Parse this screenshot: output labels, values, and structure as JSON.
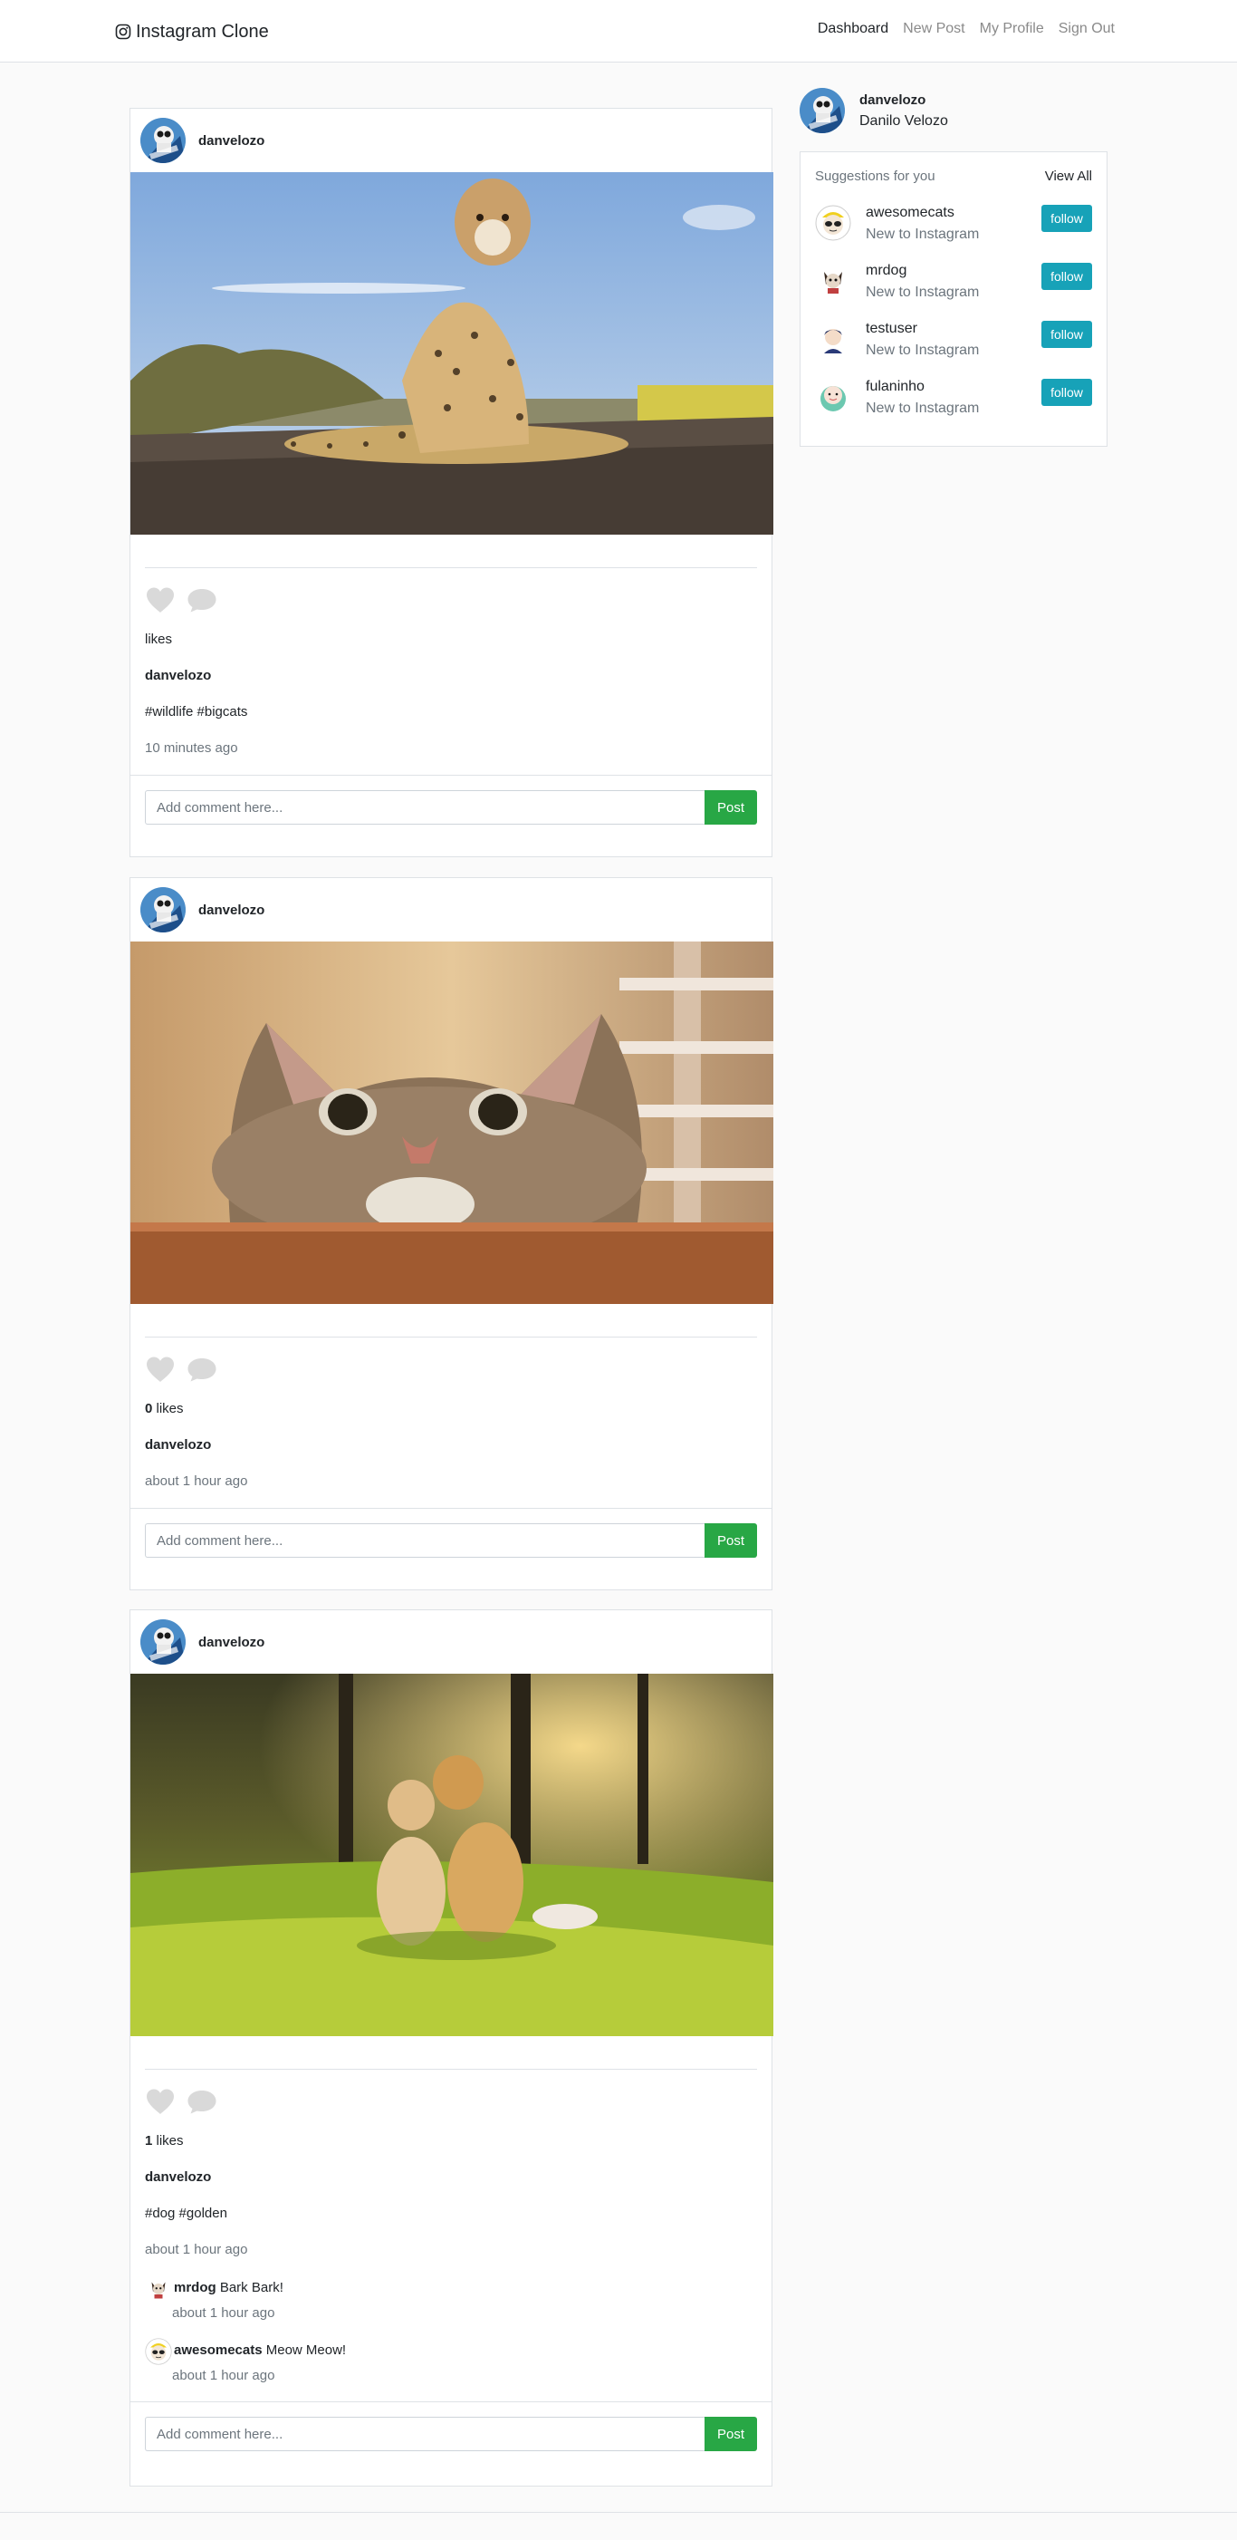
{
  "navbar": {
    "brand": "Instagram Clone",
    "links": [
      "Dashboard",
      "New Post",
      "My Profile",
      "Sign Out"
    ]
  },
  "posts": [
    {
      "username": "danvelozo",
      "likes_count": "",
      "likes_label": "likes",
      "author": "danvelozo",
      "caption": "#wildlife #bigcats",
      "time": "10 minutes ago",
      "comments": [],
      "comment_placeholder": "Add comment here...",
      "post_button": "Post"
    },
    {
      "username": "danvelozo",
      "likes_count": "0",
      "likes_label": " likes",
      "author": "danvelozo",
      "caption": "",
      "time": "about 1 hour ago",
      "comments": [],
      "comment_placeholder": "Add comment here...",
      "post_button": "Post"
    },
    {
      "username": "danvelozo",
      "likes_count": "1",
      "likes_label": " likes",
      "author": "danvelozo",
      "caption": "#dog #golden",
      "time": "about 1 hour ago",
      "comments": [
        {
          "user": "mrdog",
          "text": " Bark Bark!",
          "time": "about 1 hour ago"
        },
        {
          "user": "awesomecats",
          "text": " Meow Meow!",
          "time": "about 1 hour ago"
        }
      ],
      "comment_placeholder": "Add comment here...",
      "post_button": "Post"
    }
  ],
  "sidebar": {
    "username": "danvelozo",
    "full_name": "Danilo Velozo",
    "suggestions_title": "Suggestions for you",
    "view_all": "View All",
    "suggestions": [
      {
        "username": "awesomecats",
        "subtitle": "New to Instagram",
        "button": "follow"
      },
      {
        "username": "mrdog",
        "subtitle": "New to Instagram",
        "button": "follow"
      },
      {
        "username": "testuser",
        "subtitle": "New to Instagram",
        "button": "follow"
      },
      {
        "username": "fulaninho",
        "subtitle": "New to Instagram",
        "button": "follow"
      }
    ]
  }
}
